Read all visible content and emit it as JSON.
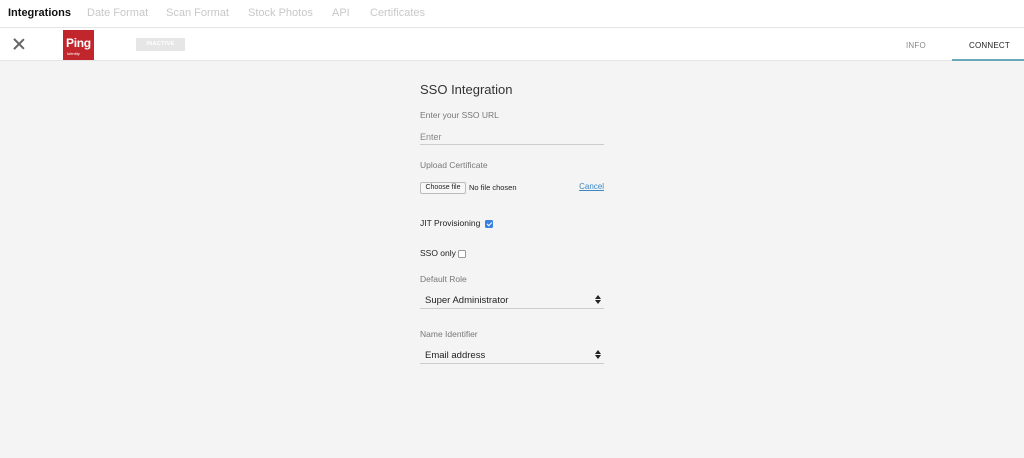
{
  "topnav": {
    "tabs": [
      "Integrations",
      "Date Format",
      "Scan Format",
      "Stock Photos",
      "API",
      "Certificates"
    ]
  },
  "header": {
    "logo": {
      "word": "Ping",
      "sub": "Identity",
      "color": "#c0262c"
    },
    "status_badge": "INACTIVE",
    "tabs": {
      "info": "INFO",
      "connect": "CONNECT"
    },
    "accent": "#6aa7b8"
  },
  "form": {
    "title": "SSO Integration",
    "sso_url": {
      "label": "Enter your SSO URL",
      "placeholder": "Enter",
      "value": ""
    },
    "certificate": {
      "label": "Upload Certificate",
      "choose_label": "Choose file",
      "no_file": "No file chosen",
      "cancel_label": "Cancel"
    },
    "jit": {
      "label": "JIT Provisioning",
      "checked": true
    },
    "sso_only": {
      "label": "SSO only",
      "checked": false
    },
    "default_role": {
      "label": "Default Role",
      "value": "Super Administrator"
    },
    "name_identifier": {
      "label": "Name Identifier",
      "value": "Email address"
    }
  }
}
